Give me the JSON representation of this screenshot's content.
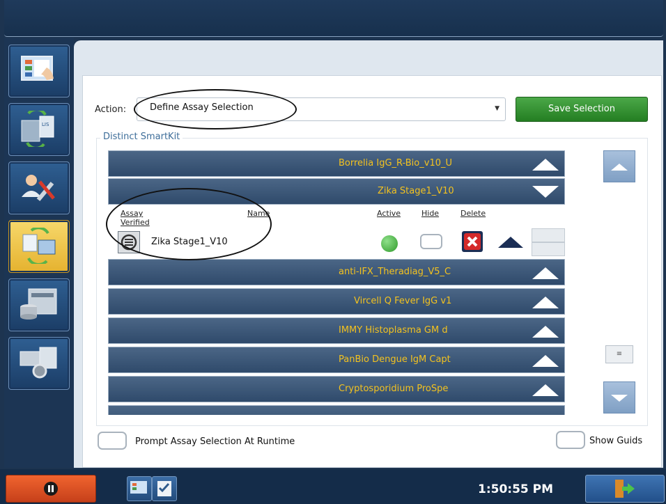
{
  "nav": {
    "items": [
      {
        "icon": "monitor-touch-icon"
      },
      {
        "icon": "lis-link-icon"
      },
      {
        "icon": "user-tools-icon"
      },
      {
        "icon": "assay-sync-icon",
        "active": true
      },
      {
        "icon": "instrument-database-icon"
      },
      {
        "icon": "instrument-settings-icon"
      }
    ]
  },
  "form": {
    "action_label": "Action:",
    "action_value": "Define Assay Selection",
    "save_label": "Save Selection",
    "group_label": "Distinct SmartKit"
  },
  "list": {
    "rows_above": [
      {
        "title": "Borrelia IgG_R-Bio_v10_U",
        "expanded": false
      }
    ],
    "expanded_row": {
      "title": "Zika Stage1_V10",
      "expanded": true
    },
    "columns": {
      "assay_verified": "Assay Verified",
      "name": "Name",
      "active": "Active",
      "hide": "Hide",
      "delete": "Delete"
    },
    "detail": {
      "name": "Zika Stage1_V10",
      "active": true,
      "hide": false
    },
    "rows_below": [
      {
        "title": "anti-IFX_Theradiag_V5_C"
      },
      {
        "title": "Vircell Q Fever IgG v1"
      },
      {
        "title": "IMMY Histoplasma GM d"
      },
      {
        "title": "PanBio Dengue IgM Capt"
      },
      {
        "title": "Cryptosporidium ProSpe"
      }
    ]
  },
  "options": {
    "prompt_label": "Prompt Assay Selection At Runtime",
    "guids_label": "Show Guids"
  },
  "taskbar": {
    "clock": "1:50:55 PM"
  },
  "colors": {
    "row_title": "#f3c21f",
    "save_green": "#2f8f2c",
    "active_nav": "#e8b934"
  }
}
